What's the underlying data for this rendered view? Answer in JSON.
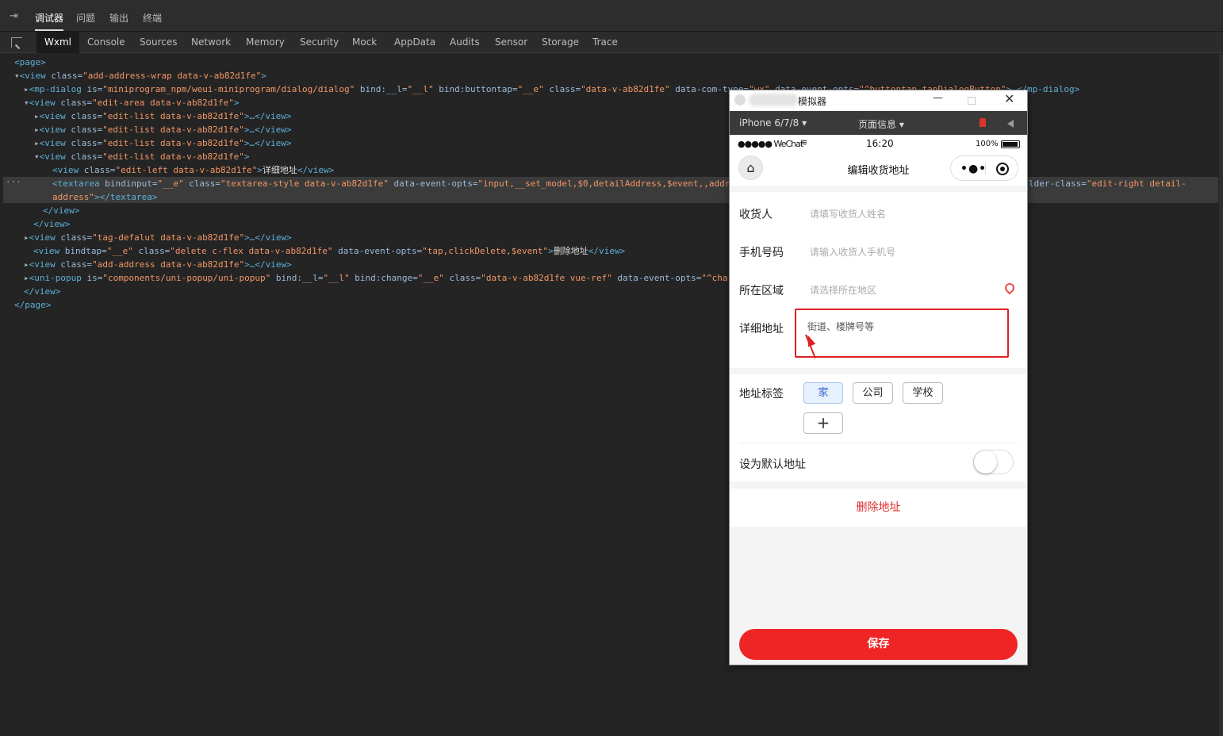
{
  "devtools": {
    "dock_icon": "⇥",
    "top_tabs": [
      "调试器",
      "问题",
      "输出",
      "终端"
    ],
    "panel_tabs": [
      "Wxml",
      "Console",
      "Sources",
      "Network",
      "Memory",
      "Security",
      "Mock",
      "AppData",
      "Audits",
      "Sensor",
      "Storage",
      "Trace"
    ],
    "ellipsis": "···"
  },
  "wxml": {
    "l1": "<page>",
    "l2a": "<view",
    "l2b": " class=",
    "l2c": "\"add-address-wrap data-v-ab82d1fe\"",
    "l2d": ">",
    "l3a": "<mp-dialog",
    "l3b": " is=",
    "l3c": "\"miniprogram_npm/weui-miniprogram/dialog/dialog\"",
    "l3d": " bind:__l=",
    "l3e": "\"__l\"",
    "l3f": " bind:buttontap=",
    "l3g": "\"__e\"",
    "l3h": " class=",
    "l3i": "\"data-v-ab82d1fe\"",
    "l3j": " data-com-type=",
    "l3k": "\"wx\"",
    "l3l": " data-event-opts=",
    "l3m": "\"^buttontap,tapDialogButton\"",
    "l3n": ">…</mp-dialog>",
    "l4a": "<view",
    "l4b": " class=",
    "l4c": "\"edit-area data-v-ab82d1fe\"",
    "l4d": ">",
    "l5a": "<view",
    "l5b": " class=",
    "l5c": "\"edit-list data-v-ab82d1fe\"",
    "l5d": ">…</view>",
    "l6a": "<view",
    "l6b": " class=",
    "l6c": "\"edit-list data-v-ab82d1fe\"",
    "l6d": ">…</view>",
    "l7a": "<view",
    "l7b": " class=",
    "l7c": "\"edit-list data-v-ab82d1fe\"",
    "l7d": ">…</view>",
    "l8a": "<view",
    "l8b": " class=",
    "l8c": "\"edit-list data-v-ab82d1fe\"",
    "l8d": ">",
    "l9a": "<view",
    "l9b": " class=",
    "l9c": "\"edit-left data-v-ab82d1fe\"",
    "l9d": ">",
    "l9e": "详细地址",
    "l9f": "</view>",
    "l10a": "<textarea",
    "l10b": " bindinput=",
    "l10c": "\"__e\"",
    "l10d": " class=",
    "l10e": "\"textarea-style data-v-ab82d1fe\"",
    "l10f": " data-event-opts=",
    "l10g": "\"input,__set_model,$0,detailAddress,$event,,addr",
    "l10h": "lder-class=",
    "l10i": "\"edit-right detail-",
    "l11a": "address\"",
    "l11b": "></textarea>",
    "l12": "</view>",
    "l13": "</view>",
    "l14a": "<view",
    "l14b": " class=",
    "l14c": "\"tag-defalut data-v-ab82d1fe\"",
    "l14d": ">…</view>",
    "l15a": "<view",
    "l15b": " bindtap=",
    "l15c": "\"__e\"",
    "l15d": " class=",
    "l15e": "\"delete c-flex data-v-ab82d1fe\"",
    "l15f": " data-event-opts=",
    "l15g": "\"tap,clickDelete,$event\"",
    "l15h": ">",
    "l15i": "删除地址",
    "l15j": "</view>",
    "l16a": "<view",
    "l16b": " class=",
    "l16c": "\"add-address data-v-ab82d1fe\"",
    "l16d": ">…</view>",
    "l17a": "<uni-popup",
    "l17b": " is=",
    "l17c": "\"components/uni-popup/uni-popup\"",
    "l17d": " bind:__l=",
    "l17e": "\"__l\"",
    "l17f": " bind:change=",
    "l17g": "\"__e\"",
    "l17h": " class=",
    "l17i": "\"data-v-ab82d1fe vue-ref\"",
    "l17j": " data-event-opts=",
    "l17k": "\"^cha",
    "l18": "</view>",
    "l19": "</page>"
  },
  "simulator": {
    "title": "模拟器",
    "device": "iPhone 6/7/8 ▾",
    "page_info": "页面信息 ▾",
    "status": {
      "signal": "●●●●● WeChat",
      "wifi": "≋",
      "time": "16:20",
      "battery": "100%"
    },
    "nav_title": "编辑收货地址",
    "capsule_more": "•●•",
    "form": {
      "receiver_label": "收货人",
      "receiver_placeholder": "请填写收货人姓名",
      "phone_label": "手机号码",
      "phone_placeholder": "请输入收货人手机号",
      "region_label": "所在区域",
      "region_placeholder": "请选择所在地区",
      "detail_label": "详细地址",
      "detail_placeholder": "街道、楼牌号等"
    },
    "tags": {
      "label": "地址标签",
      "options": [
        "家",
        "公司",
        "学校"
      ],
      "add": "+"
    },
    "default_label": "设为默认地址",
    "delete_label": "删除地址",
    "save_label": "保存",
    "colors": {
      "accent": "#ef2525",
      "selected_tag_bg": "#e6f0ff",
      "annotation": "#e02020"
    }
  }
}
